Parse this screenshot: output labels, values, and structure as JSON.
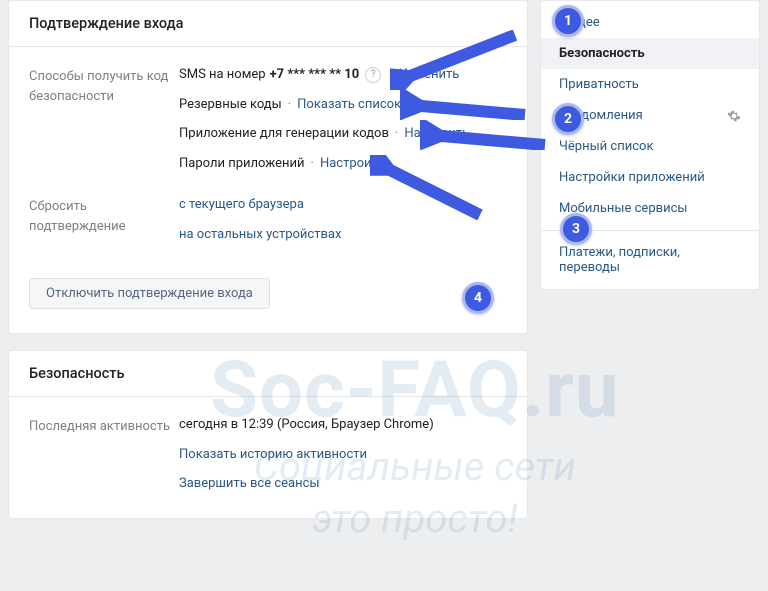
{
  "confirm": {
    "title": "Подтверждение входа",
    "methods_label": "Способы получить код безопасности",
    "sms_prefix": "SMS на номер ",
    "sms_number": "+7 *** *** ** 10",
    "change": "Изменить",
    "backup": "Резервные коды",
    "show_list": "Показать список",
    "app": "Приложение для генерации кодов",
    "configure": "Настроить",
    "app_pw": "Пароли приложений",
    "reset_label": "Сбросить подтверждение",
    "reset_browser": "с текущего браузера",
    "reset_other": "на остальных устройствах",
    "disable_btn": "Отключить подтверждение входа"
  },
  "security": {
    "title": "Безопасность",
    "activity_label": "Последняя активность",
    "activity_value": "сегодня в 12:39 (Россия, Браузер Chrome)",
    "show_history": "Показать историю активности",
    "end_sessions": "Завершить все сеансы"
  },
  "nav": {
    "items": {
      "0": "Общее",
      "1": "Безопасность",
      "2": "Приватность",
      "3": "Уведомления",
      "4": "Чёрный список",
      "5": "Настройки приложений",
      "6": "Мобильные сервисы",
      "7": "Платежи, подписки, переводы"
    }
  },
  "badges": {
    "b1": "1",
    "b2": "2",
    "b3": "3",
    "b4": "4"
  },
  "watermark": {
    "line1": "Soc-FAQ.ru",
    "line2": "Социальные сети",
    "line3": "это просто!"
  }
}
